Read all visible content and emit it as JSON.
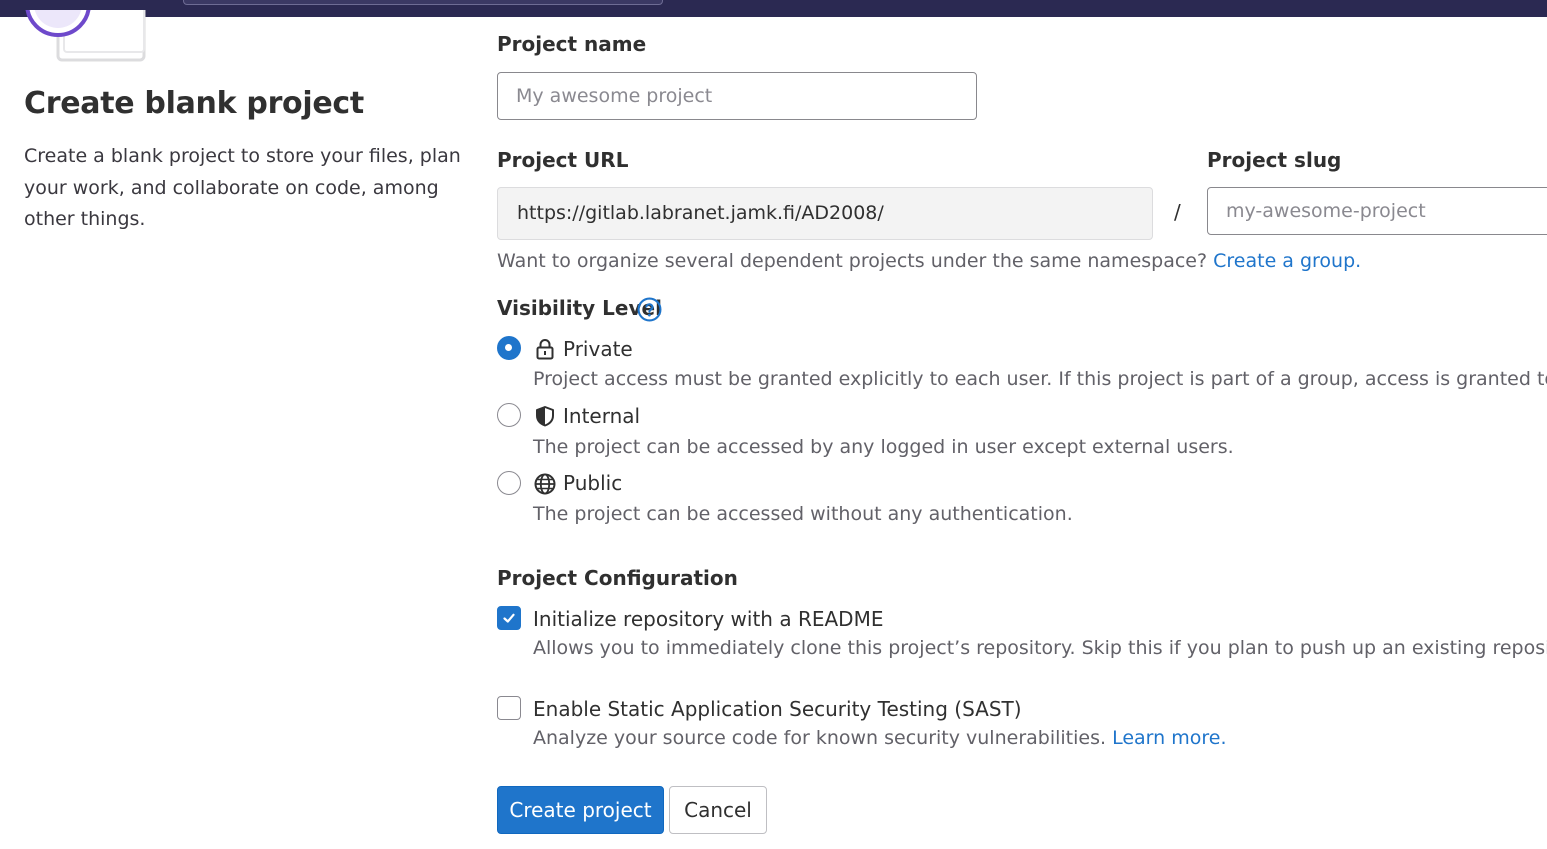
{
  "left": {
    "title": "Create blank project",
    "description": "Create a blank project to store your files, plan your work, and collaborate on code, among other things."
  },
  "project_name": {
    "label": "Project name",
    "placeholder": "My awesome project"
  },
  "project_url": {
    "label": "Project URL",
    "value": "https://gitlab.labranet.jamk.fi/AD2008/",
    "separator": "/"
  },
  "project_slug": {
    "label": "Project slug",
    "placeholder": "my-awesome-project"
  },
  "namespace_help": {
    "text": "Want to organize several dependent projects under the same namespace? ",
    "link": "Create a group."
  },
  "visibility": {
    "label": "Visibility Level",
    "options": [
      {
        "label": "Private",
        "icon": "lock-icon",
        "description": "Project access must be granted explicitly to each user. If this project is part of a group, access is granted to me",
        "checked": true
      },
      {
        "label": "Internal",
        "icon": "shield-icon",
        "description": "The project can be accessed by any logged in user except external users.",
        "checked": false
      },
      {
        "label": "Public",
        "icon": "globe-icon",
        "description": "The project can be accessed without any authentication.",
        "checked": false
      }
    ]
  },
  "configuration": {
    "label": "Project Configuration",
    "readme": {
      "label": "Initialize repository with a README",
      "description": "Allows you to immediately clone this project’s repository. Skip this if you plan to push up an existing repositor",
      "checked": true
    },
    "sast": {
      "label": "Enable Static Application Security Testing (SAST)",
      "description": "Analyze your source code for known security vulnerabilities. ",
      "link": "Learn more.",
      "checked": false
    }
  },
  "actions": {
    "create": "Create project",
    "cancel": "Cancel"
  },
  "colors": {
    "primary": "#1f75cb",
    "top_bar": "#2b2952",
    "illustration_accent": "#6e49cb"
  }
}
